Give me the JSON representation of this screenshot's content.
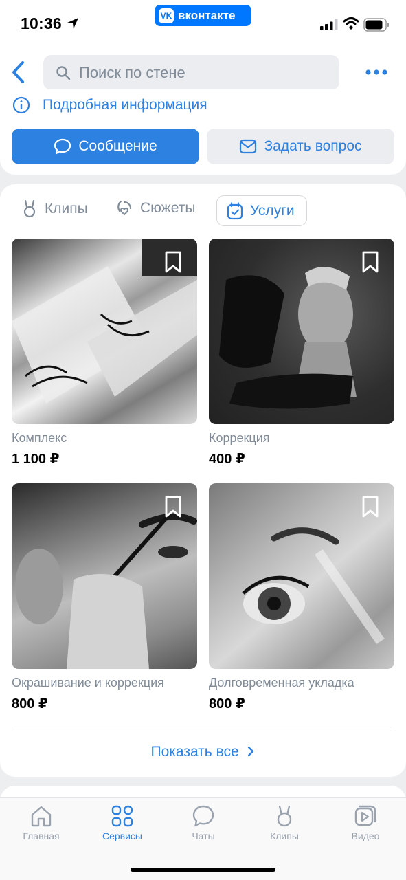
{
  "status": {
    "time": "10:36",
    "app_badge": "вконтакте",
    "vk_logo": "VK"
  },
  "header": {
    "search_placeholder": "Поиск по стене"
  },
  "profile": {
    "info_label": "Подробная информация",
    "message_button": "Сообщение",
    "ask_button": "Задать вопрос"
  },
  "tabs": [
    {
      "label": "Клипы"
    },
    {
      "label": "Сюжеты"
    },
    {
      "label": "Услуги"
    }
  ],
  "services": [
    {
      "name": "Комплекс",
      "price": "1 100 ₽"
    },
    {
      "name": "Коррекция",
      "price": "400 ₽"
    },
    {
      "name": "Окрашивание и коррекция",
      "price": "800 ₽"
    },
    {
      "name": "Долговременная укладка",
      "price": "800 ₽"
    }
  ],
  "show_all": "Показать все",
  "nav": [
    {
      "label": "Главная"
    },
    {
      "label": "Сервисы"
    },
    {
      "label": "Чаты"
    },
    {
      "label": "Клипы"
    },
    {
      "label": "Видео"
    }
  ],
  "colors": {
    "accent": "#2d81e0",
    "vk_brand": "#0077ff",
    "muted": "#818c99"
  }
}
